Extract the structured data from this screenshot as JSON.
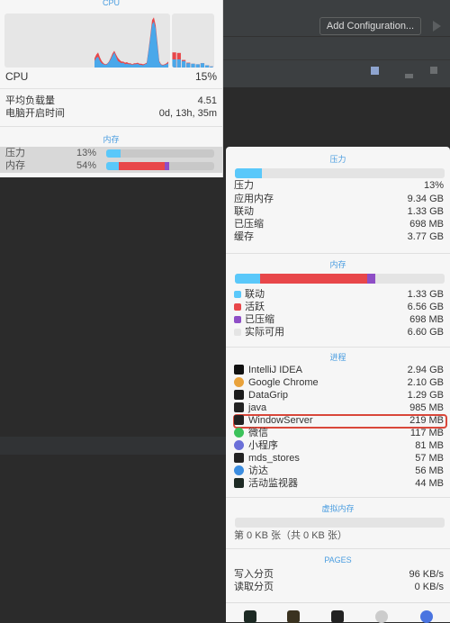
{
  "ide": {
    "add_configuration": "Add Configuration..."
  },
  "cpu_panel": {
    "title": "CPU",
    "history_system": [
      0,
      0,
      0,
      0,
      0,
      0,
      0,
      0,
      0,
      0,
      0,
      0,
      0,
      0,
      0,
      0,
      0,
      0,
      0,
      0,
      0,
      0,
      0,
      0,
      0,
      0,
      0,
      0,
      0,
      0,
      0,
      0,
      0,
      0,
      0,
      0,
      0,
      0,
      0,
      0,
      0,
      0,
      0,
      0,
      0,
      0,
      0,
      0,
      0,
      0,
      5,
      6,
      8,
      7,
      4,
      2,
      1,
      1,
      1,
      3,
      4,
      3,
      4,
      6,
      4,
      3,
      2,
      3,
      3,
      2,
      2,
      1,
      2,
      2,
      2,
      2,
      2,
      2,
      1,
      2,
      3,
      4,
      8,
      8,
      6,
      5,
      2,
      1,
      1,
      1,
      2,
      3
    ],
    "history_user": [
      0,
      0,
      0,
      0,
      0,
      0,
      0,
      0,
      0,
      0,
      0,
      0,
      0,
      0,
      0,
      0,
      0,
      0,
      0,
      0,
      0,
      0,
      0,
      0,
      0,
      0,
      0,
      0,
      0,
      0,
      0,
      0,
      0,
      0,
      0,
      0,
      0,
      0,
      0,
      0,
      0,
      0,
      0,
      0,
      0,
      0,
      0,
      0,
      0,
      0,
      12,
      18,
      20,
      12,
      8,
      6,
      5,
      6,
      10,
      15,
      22,
      28,
      20,
      12,
      10,
      8,
      9,
      6,
      7,
      6,
      6,
      5,
      6,
      6,
      7,
      5,
      5,
      4,
      6,
      7,
      30,
      55,
      80,
      85,
      72,
      40,
      10,
      5,
      4,
      5,
      6,
      8
    ],
    "recent_system": [
      13,
      12,
      2,
      1,
      0,
      0,
      0,
      0,
      0
    ],
    "recent_user": [
      15,
      15,
      12,
      8,
      7,
      6,
      8,
      4,
      2
    ],
    "cpu_label": "CPU",
    "cpu_value": "15%",
    "load_label": "平均负载量",
    "load_value": "4.51",
    "uptime_label": "电脑开启时间",
    "uptime_value": "0d, 13h, 35m",
    "memory_title": "内存",
    "pressure_label": "压力",
    "pressure_value": "13%",
    "pressure_fraction": 0.13,
    "memory_label": "内存",
    "memory_value": "54%",
    "memory_segments": [
      0.12,
      0.42,
      0.04
    ]
  },
  "detail": {
    "pressure_title": "压力",
    "pressure_fraction": 0.13,
    "pressure_rows": [
      {
        "label": "压力",
        "value": "13%"
      }
    ],
    "usage_rows": [
      {
        "label": "应用内存",
        "value": "9.34 GB"
      },
      {
        "label": "联动",
        "value": "1.33 GB"
      },
      {
        "label": "已压缩",
        "value": "698 MB"
      },
      {
        "label": "缓存",
        "value": "3.77 GB"
      }
    ],
    "memory_title": "内存",
    "memory_rows": [
      {
        "label": "联动",
        "value": "1.33 GB",
        "color": "#5ac8fa"
      },
      {
        "label": "活跃",
        "value": "6.56 GB",
        "color": "#e8474a"
      },
      {
        "label": "已压缩",
        "value": "698 MB",
        "color": "#8e4ec6"
      },
      {
        "label": "实际可用",
        "value": "6.60 GB",
        "color": "#e4e4e4"
      }
    ],
    "process_title": "进程",
    "processes": [
      {
        "name": "IntelliJ IDEA",
        "value": "2.94 GB",
        "icon": "intellij-icon"
      },
      {
        "name": "Google Chrome",
        "value": "2.10 GB",
        "icon": "chrome-icon"
      },
      {
        "name": "DataGrip",
        "value": "1.29 GB",
        "icon": "datagrip-icon"
      },
      {
        "name": "java",
        "value": "985 MB",
        "icon": "terminal-icon"
      },
      {
        "name": "WindowServer",
        "value": "219 MB",
        "icon": "terminal-icon"
      },
      {
        "name": "微信",
        "value": "117 MB",
        "icon": "wechat-icon"
      },
      {
        "name": "小程序",
        "value": "81 MB",
        "icon": "miniprogram-icon"
      },
      {
        "name": "mds_stores",
        "value": "57 MB",
        "icon": "terminal-icon"
      },
      {
        "name": "访达",
        "value": "56 MB",
        "icon": "finder-icon"
      },
      {
        "name": "活动监视器",
        "value": "44 MB",
        "icon": "activity-monitor-icon"
      }
    ],
    "vm_title": "虚拟内存",
    "vm_text": "第 0 KB 张（共 0 KB 张）",
    "pages_title": "PAGES",
    "pages_rows": [
      {
        "label": "写入分页",
        "value": "96 KB/s"
      },
      {
        "label": "读取分页",
        "value": "0 KB/s"
      }
    ]
  }
}
